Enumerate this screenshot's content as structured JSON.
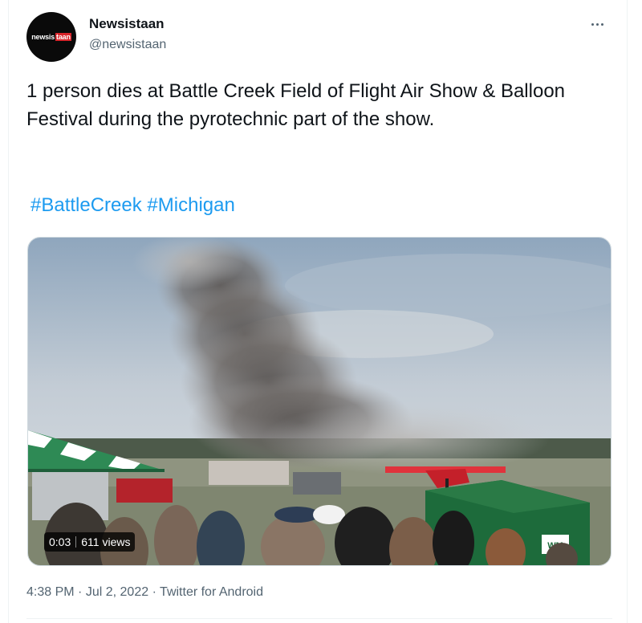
{
  "account": {
    "display_name": "Newsistaan",
    "handle": "@newsistaan",
    "avatar_logo_part1": "newsis",
    "avatar_logo_part2": "taan"
  },
  "tweet": {
    "text": "1 person dies at Battle Creek Field of Flight Air Show & Balloon Festival during the pyrotechnic part of the show.",
    "hashtags": [
      "#BattleCreek",
      "#Michigan"
    ]
  },
  "media": {
    "duration": "0:03",
    "views": "611 views",
    "dumpster_logo": "WM"
  },
  "meta": {
    "time": "4:38 PM",
    "separator": "·",
    "date": "Jul 2, 2022",
    "source": "Twitter for Android"
  },
  "icons": {
    "more": "more-options-icon"
  },
  "colors": {
    "link": "#1d9bf0",
    "text_primary": "#0f1419",
    "text_secondary": "#536471",
    "avatar_accent": "#d9252b"
  }
}
